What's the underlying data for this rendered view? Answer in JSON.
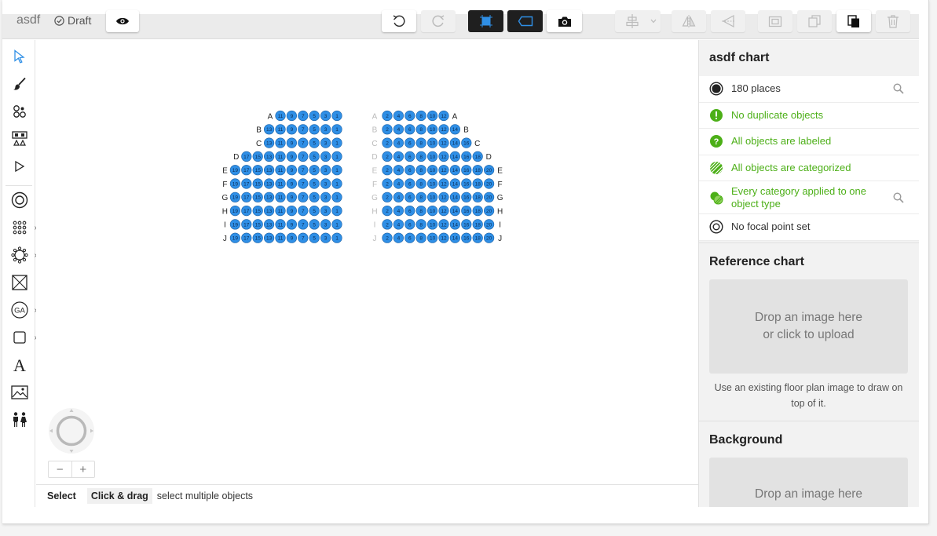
{
  "app": {
    "chart_name": "asdf",
    "status": "Draft"
  },
  "statusbar": {
    "mode": "Select",
    "hint_key": "Click & drag",
    "hint_desc": "select multiple objects"
  },
  "panel": {
    "title": "asdf chart",
    "checks": [
      {
        "text": "180 places",
        "tone": "dark",
        "icon": "places-icon",
        "search": true
      },
      {
        "text": "No duplicate objects",
        "tone": "green",
        "icon": "warning-circle-icon",
        "search": false
      },
      {
        "text": "All objects are labeled",
        "tone": "green",
        "icon": "question-circle-icon",
        "search": false
      },
      {
        "text": "All objects are categorized",
        "tone": "green",
        "icon": "striped-circle-icon",
        "search": false
      },
      {
        "text": "Every category applied to one object type",
        "tone": "green",
        "icon": "category-overlap-icon",
        "search": true
      },
      {
        "text": "No focal point set",
        "tone": "dark",
        "icon": "focal-point-icon",
        "search": false
      }
    ],
    "reference": {
      "heading": "Reference chart",
      "drop_line1": "Drop an image here",
      "drop_line2": "or click to upload",
      "note": "Use an existing floor plan image to draw on top of it."
    },
    "background": {
      "heading": "Background",
      "drop_line1": "Drop an image here"
    }
  },
  "zoom": {
    "minus": "−",
    "plus": "+"
  },
  "seating": {
    "seat_color": "#2f8fe6",
    "left_block": {
      "rows": [
        {
          "label": "A",
          "seats": [
            "11",
            "9",
            "7",
            "5",
            "3",
            "1"
          ]
        },
        {
          "label": "B",
          "seats": [
            "13",
            "11",
            "9",
            "7",
            "5",
            "3",
            "1"
          ]
        },
        {
          "label": "C",
          "seats": [
            "13",
            "11",
            "9",
            "7",
            "5",
            "3",
            "1"
          ]
        },
        {
          "label": "D",
          "seats": [
            "17",
            "15",
            "13",
            "11",
            "9",
            "7",
            "5",
            "3",
            "1"
          ]
        },
        {
          "label": "E",
          "seats": [
            "19",
            "17",
            "15",
            "13",
            "11",
            "9",
            "7",
            "5",
            "3",
            "1"
          ]
        },
        {
          "label": "F",
          "seats": [
            "19",
            "17",
            "15",
            "13",
            "11",
            "9",
            "7",
            "5",
            "3",
            "1"
          ]
        },
        {
          "label": "G",
          "seats": [
            "19",
            "17",
            "15",
            "13",
            "11",
            "9",
            "7",
            "5",
            "3",
            "1"
          ]
        },
        {
          "label": "H",
          "seats": [
            "19",
            "17",
            "15",
            "13",
            "11",
            "9",
            "7",
            "5",
            "3",
            "1"
          ]
        },
        {
          "label": "I",
          "seats": [
            "19",
            "17",
            "15",
            "13",
            "11",
            "9",
            "7",
            "5",
            "3",
            "1"
          ]
        },
        {
          "label": "J",
          "seats": [
            "19",
            "17",
            "15",
            "13",
            "11",
            "9",
            "7",
            "5",
            "3",
            "1"
          ]
        }
      ]
    },
    "right_block": {
      "rows": [
        {
          "label": "A",
          "seats": [
            "2",
            "4",
            "6",
            "8",
            "10",
            "12"
          ]
        },
        {
          "label": "B",
          "seats": [
            "2",
            "4",
            "6",
            "8",
            "10",
            "12",
            "14"
          ]
        },
        {
          "label": "C",
          "seats": [
            "2",
            "4",
            "6",
            "8",
            "10",
            "12",
            "14",
            "16"
          ]
        },
        {
          "label": "D",
          "seats": [
            "2",
            "4",
            "6",
            "8",
            "10",
            "12",
            "14",
            "16",
            "18"
          ]
        },
        {
          "label": "E",
          "seats": [
            "2",
            "4",
            "6",
            "8",
            "10",
            "12",
            "14",
            "16",
            "18",
            "20"
          ]
        },
        {
          "label": "F",
          "seats": [
            "2",
            "4",
            "6",
            "8",
            "10",
            "12",
            "14",
            "16",
            "18",
            "20"
          ]
        },
        {
          "label": "G",
          "seats": [
            "2",
            "4",
            "6",
            "8",
            "10",
            "12",
            "14",
            "16",
            "18",
            "20"
          ]
        },
        {
          "label": "H",
          "seats": [
            "2",
            "4",
            "6",
            "8",
            "10",
            "12",
            "14",
            "16",
            "18",
            "20"
          ]
        },
        {
          "label": "I",
          "seats": [
            "2",
            "4",
            "6",
            "8",
            "10",
            "12",
            "14",
            "16",
            "18",
            "20"
          ]
        },
        {
          "label": "J",
          "seats": [
            "2",
            "4",
            "6",
            "8",
            "10",
            "12",
            "14",
            "16",
            "18",
            "20"
          ]
        }
      ]
    }
  }
}
